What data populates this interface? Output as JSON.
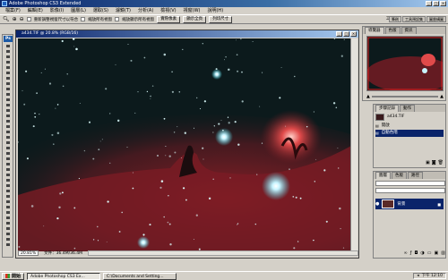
{
  "app": {
    "title": "Adobe Photoshop CS3 Extended"
  },
  "menu": [
    "檔案(F)",
    "編輯(E)",
    "影像(I)",
    "圖層(L)",
    "選取(S)",
    "濾鏡(T)",
    "分析(A)",
    "檢視(V)",
    "視窗(W)",
    "說明(H)"
  ],
  "options": {
    "check1_label": "重新調整視窗尺寸以符合",
    "check2_label": "縮放所有視窗",
    "check3_label": "縮放顯示所有視窗",
    "btn_actual": "實際像素",
    "btn_fit": "顯示全頁",
    "btn_print": "列印尺寸",
    "workspace": "工作區 ▾"
  },
  "right_tabs": [
    "筆刷",
    "工具預設集",
    "圖層構圖"
  ],
  "document": {
    "title": "a434.TIF @ 20.8% (RGB/16)",
    "zoom": "20.81%",
    "docinfo": "文件：36.4M/36.4M"
  },
  "navigator": {
    "tabs": [
      "導覽器",
      "色版",
      "資訊"
    ]
  },
  "history": {
    "tabs": [
      "步驟記錄",
      "動作"
    ],
    "snapshot": "a434.TIF",
    "items": [
      "開啟",
      "自動色階"
    ]
  },
  "layers": {
    "tabs": [
      "圖層",
      "色版",
      "路徑"
    ],
    "layer_name": "背景"
  },
  "taskbar": {
    "start": "開始",
    "tasks": [
      "Adobe Photoshop CS3 Ex...",
      "C:\\Documents and Setting..."
    ],
    "clock": "下午 12:10"
  },
  "colors": {
    "nebula": "#b0282f",
    "sky": "#0c1a1c",
    "selection": "#0a246a"
  }
}
